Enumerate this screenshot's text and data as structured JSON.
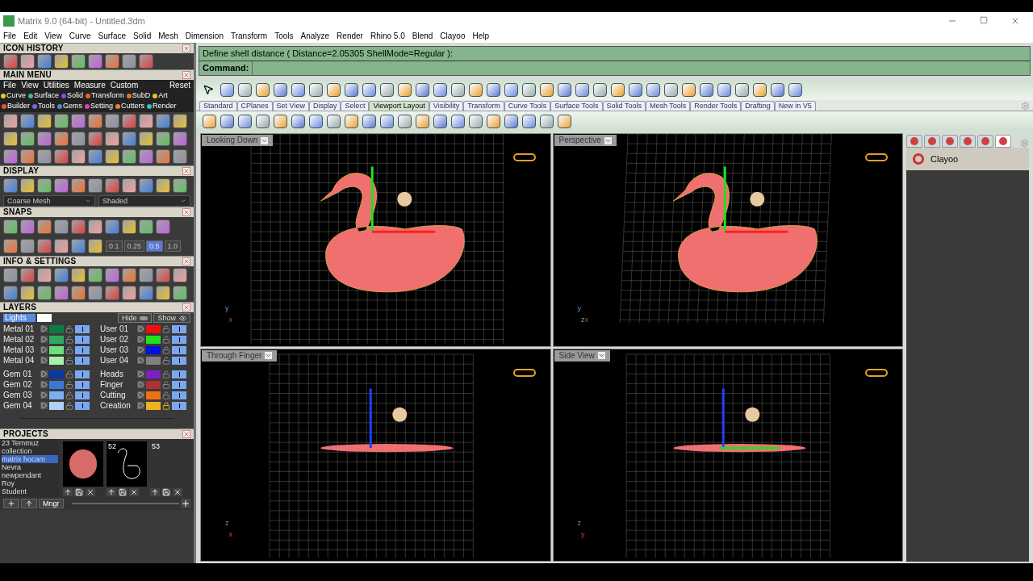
{
  "window": {
    "title": "Matrix 9.0 (64-bit) - Untitled.3dm"
  },
  "menu_bar": [
    "File",
    "Edit",
    "View",
    "Curve",
    "Surface",
    "Solid",
    "Mesh",
    "Dimension",
    "Transform",
    "Tools",
    "Analyze",
    "Render",
    "Rhino 5.0",
    "Blend",
    "Clayoo",
    "Help"
  ],
  "left_panel": {
    "icon_history": {
      "title": "ICON HISTORY"
    },
    "main_menu": {
      "title": "MAIN MENU",
      "items": [
        "File",
        "View",
        "Utilities",
        "Measure",
        "Custom"
      ],
      "reset": "Reset",
      "categories": [
        {
          "label": "Curve",
          "color": "#e8c832"
        },
        {
          "label": "Surface",
          "color": "#3cb8a0"
        },
        {
          "label": "Solid",
          "color": "#a040e0"
        },
        {
          "label": "Transform",
          "color": "#f06030"
        },
        {
          "label": "SubD",
          "color": "#f07020"
        },
        {
          "label": "Art",
          "color": "#e8c020"
        },
        {
          "label": "Builder",
          "color": "#f05030"
        },
        {
          "label": "Tools",
          "color": "#8060e0"
        },
        {
          "label": "Gems",
          "color": "#4090e0"
        },
        {
          "label": "Setting",
          "color": "#e040c0"
        },
        {
          "label": "Cutters",
          "color": "#f08030"
        },
        {
          "label": "Render",
          "color": "#30c0c0"
        }
      ]
    },
    "display": {
      "title": "DISPLAY",
      "mesh": "Coarse Mesh",
      "shading": "Shaded"
    },
    "snaps": {
      "title": "SNAPS",
      "steps": [
        {
          "label": "0.1",
          "selected": false
        },
        {
          "label": "0.25",
          "selected": false
        },
        {
          "label": "0.5",
          "selected": true
        },
        {
          "label": "1.0",
          "selected": false
        }
      ]
    },
    "info_settings": {
      "title": "INFO & SETTINGS"
    },
    "layers": {
      "title": "LAYERS",
      "lights": {
        "label": "Lights",
        "color": "#ffffff"
      },
      "hide": "Hide",
      "show": "Show",
      "left": [
        {
          "name": "Metal 01",
          "color": "#0e7a45",
          "locked": false,
          "visible": true
        },
        {
          "name": "Metal 02",
          "color": "#2fa860",
          "locked": false,
          "visible": true
        },
        {
          "name": "Metal 03",
          "color": "#6ee07a",
          "locked": false,
          "visible": true
        },
        {
          "name": "Metal 04",
          "color": "#a8f0a8",
          "locked": false,
          "visible": true
        },
        {
          "name": "Gem 01",
          "color": "#0a3aa0",
          "locked": false,
          "visible": true
        },
        {
          "name": "Gem 02",
          "color": "#3a78d8",
          "locked": false,
          "visible": true
        },
        {
          "name": "Gem 03",
          "color": "#7ab0f0",
          "locked": false,
          "visible": true
        },
        {
          "name": "Gem 04",
          "color": "#b0d0f8",
          "locked": false,
          "visible": true
        }
      ],
      "right": [
        {
          "name": "User 01",
          "color": "#f01010",
          "locked": false,
          "visible": true
        },
        {
          "name": "User 02",
          "color": "#20e020",
          "locked": false,
          "visible": true
        },
        {
          "name": "User 03",
          "color": "#0010e0",
          "locked": false,
          "visible": true
        },
        {
          "name": "User 04",
          "color": "#808080",
          "locked": false,
          "visible": true
        },
        {
          "name": "Heads",
          "color": "#8020c0",
          "locked": false,
          "visible": true
        },
        {
          "name": "Finger",
          "color": "#b03030",
          "locked": false,
          "visible": true
        },
        {
          "name": "Cutting",
          "color": "#f07010",
          "locked": false,
          "visible": true
        },
        {
          "name": "Creation",
          "color": "#f0b020",
          "locked": true,
          "visible": true
        }
      ]
    },
    "projects": {
      "title": "PROJECTS",
      "list": [
        {
          "label": "23 Temmuz",
          "selected": false
        },
        {
          "label": "collection",
          "selected": false
        },
        {
          "label": "matrix hocam",
          "selected": true
        },
        {
          "label": "Nevra",
          "selected": false
        },
        {
          "label": "newpendant",
          "selected": false
        },
        {
          "label": "Roy",
          "selected": false
        },
        {
          "label": "Student",
          "selected": false
        }
      ],
      "thumbnails": [
        {
          "kind": "photo"
        },
        {
          "kind": "outline",
          "number": "52"
        },
        {
          "kind": "empty",
          "number": "53"
        }
      ],
      "manager": "Mngr"
    }
  },
  "command": {
    "history": "Define shell distance ( Distance=2.05305  ShellMode=Regular ):",
    "label": "Command:"
  },
  "toolbar_tabs": [
    {
      "label": "Standard",
      "selected": false
    },
    {
      "label": "CPlanes",
      "selected": false
    },
    {
      "label": "Set View",
      "selected": false
    },
    {
      "label": "Display",
      "selected": false
    },
    {
      "label": "Select",
      "selected": false
    },
    {
      "label": "Viewport Layout",
      "selected": true
    },
    {
      "label": "Visibility",
      "selected": false
    },
    {
      "label": "Transform",
      "selected": false
    },
    {
      "label": "Curve Tools",
      "selected": false
    },
    {
      "label": "Surface Tools",
      "selected": false
    },
    {
      "label": "Solid Tools",
      "selected": false
    },
    {
      "label": "Mesh Tools",
      "selected": false
    },
    {
      "label": "Render Tools",
      "selected": false
    },
    {
      "label": "Drafting",
      "selected": false
    },
    {
      "label": "New in V5",
      "selected": false
    }
  ],
  "viewports": [
    {
      "label": "Looking Down",
      "kind": "top",
      "axes": [
        "y",
        "x"
      ]
    },
    {
      "label": "Perspective",
      "kind": "perspective",
      "axes": [
        "y",
        "z",
        "x"
      ]
    },
    {
      "label": "Through Finger",
      "kind": "front",
      "axes": [
        "z",
        "x"
      ]
    },
    {
      "label": "Side View",
      "kind": "side",
      "axes": [
        "z",
        "y"
      ]
    }
  ],
  "right_panel": {
    "tabs": [
      {
        "selected": false
      },
      {
        "selected": false
      },
      {
        "selected": false
      },
      {
        "selected": false
      },
      {
        "selected": false
      },
      {
        "selected": true
      }
    ],
    "title": "Clayoo"
  }
}
